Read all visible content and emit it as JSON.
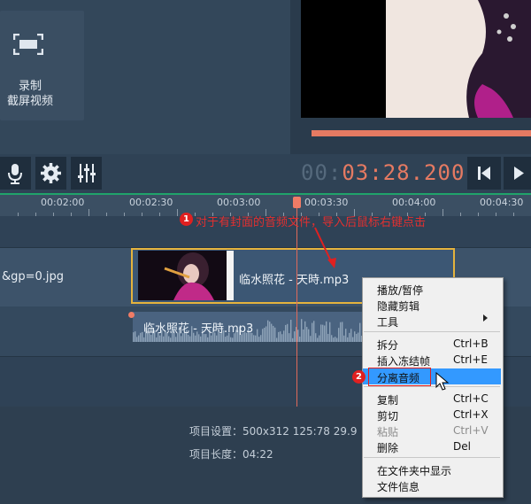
{
  "left_panel": {
    "record_label_line1": "录制",
    "record_label_line2": "截屏视频",
    "icon": "screen-capture-icon"
  },
  "toolbar": {
    "mic_icon": "microphone-icon",
    "settings_icon": "gear-icon",
    "mixer_icon": "equalizer-icon",
    "timecode_dim": "00:",
    "timecode_bright": "03:28.200",
    "prev_icon": "skip-to-start-icon",
    "play_icon": "play-icon"
  },
  "ruler": {
    "labels": [
      "00:02:00",
      "00:02:30",
      "00:03:00",
      "00:03:30",
      "00:04:00",
      "00:04:30"
    ]
  },
  "tracks": {
    "image_clip_name": "&gp=0.jpg",
    "video_clip_name": "临水照花 - 天時.mp3",
    "audio_clip_name": "临水照花 - 天時.mp3"
  },
  "annotations": {
    "step1_number": "1",
    "step1_text": "对于有封面的音频文件，导入后鼠标右键点击",
    "step2_number": "2"
  },
  "context_menu": {
    "items": [
      {
        "label": "播放/暂停",
        "shortcut": ""
      },
      {
        "label": "隐藏剪辑",
        "shortcut": ""
      },
      {
        "label": "工具",
        "shortcut": ""
      },
      {
        "label": "拆分",
        "shortcut": "Ctrl+B"
      },
      {
        "label": "插入冻结帧",
        "shortcut": "Ctrl+E"
      },
      {
        "label": "分离音频",
        "shortcut": ""
      },
      {
        "label": "复制",
        "shortcut": "Ctrl+C"
      },
      {
        "label": "剪切",
        "shortcut": "Ctrl+X"
      },
      {
        "label": "粘贴",
        "shortcut": "Ctrl+V"
      },
      {
        "label": "删除",
        "shortcut": "Del"
      },
      {
        "label": "在文件夹中显示",
        "shortcut": ""
      },
      {
        "label": "文件信息",
        "shortcut": ""
      }
    ]
  },
  "info": {
    "settings": "项目设置：500x312 125:78 29.9",
    "length": "项目长度：04:22"
  },
  "colors": {
    "accent": "#e57a62",
    "clip_border": "#e5b33d",
    "menu_highlight": "#3399ff",
    "annotation_red": "#e02020"
  }
}
